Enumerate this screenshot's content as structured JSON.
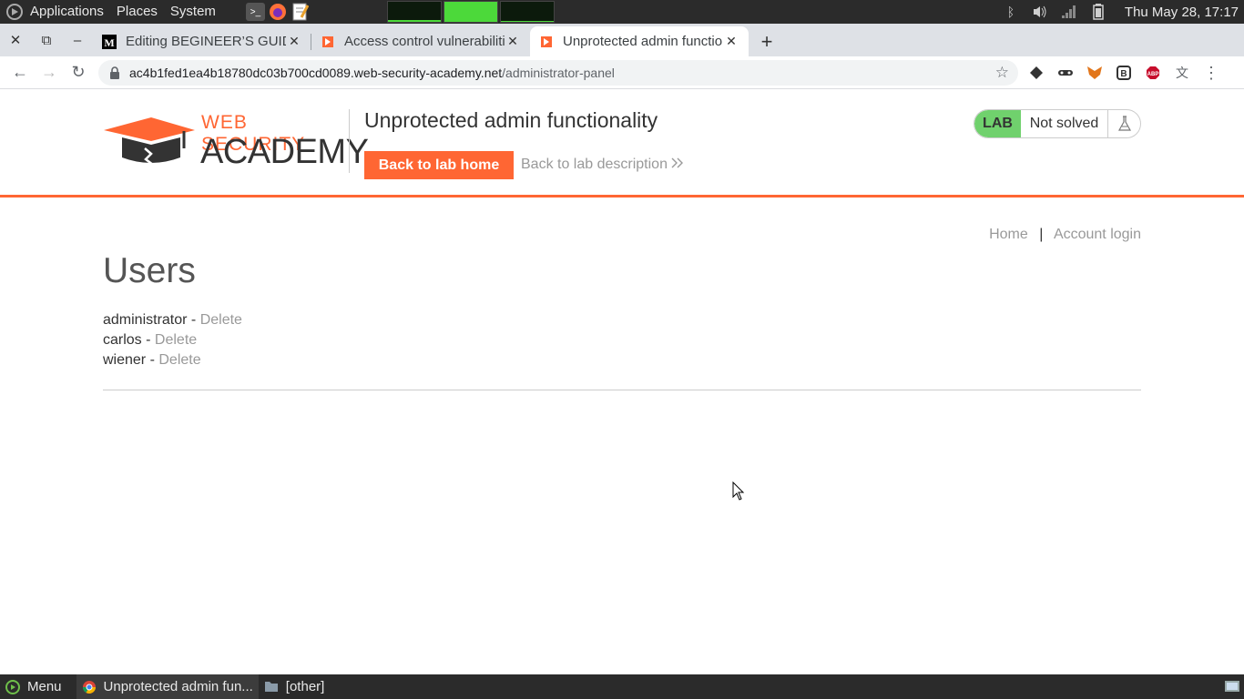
{
  "top_panel": {
    "menus": [
      "Applications",
      "Places",
      "System"
    ],
    "clock": "Thu May 28, 17:17",
    "graphs": [
      0.1,
      1.0,
      0.05
    ]
  },
  "browser": {
    "tabs": [
      {
        "title": "Editing BEGINEER’S GUIDE",
        "favicon": "medium-icon",
        "active": false
      },
      {
        "title": "Access control vulnerabilities",
        "favicon": "portswigger-icon",
        "active": false
      },
      {
        "title": "Unprotected admin functionality",
        "favicon": "portswigger-icon",
        "active": true
      }
    ],
    "url_host": "ac4b1fed1ea4b18780dc03b700cd0089.web-security-academy.net",
    "url_path": "/administrator-panel"
  },
  "lab": {
    "logo_top": "WEB SECURITY",
    "logo_bottom": "ACADEMY",
    "title": "Unprotected admin functionality",
    "back_button": "Back to lab home",
    "description_link": "Back to lab description",
    "badge_label": "LAB",
    "badge_status": "Not solved",
    "colors": {
      "accent": "#ff6633",
      "lab_badge": "#70d16d",
      "link": "#999999"
    }
  },
  "page": {
    "nav": {
      "home": "Home",
      "separator": "|",
      "login": "Account login"
    },
    "heading": "Users",
    "users": [
      {
        "name": "administrator",
        "separator": " - ",
        "action": "Delete"
      },
      {
        "name": "carlos",
        "separator": " - ",
        "action": "Delete"
      },
      {
        "name": "wiener",
        "separator": " - ",
        "action": "Delete"
      }
    ]
  },
  "bottom_panel": {
    "menu": "Menu",
    "task": "Unprotected admin fun...",
    "other": "[other]"
  }
}
